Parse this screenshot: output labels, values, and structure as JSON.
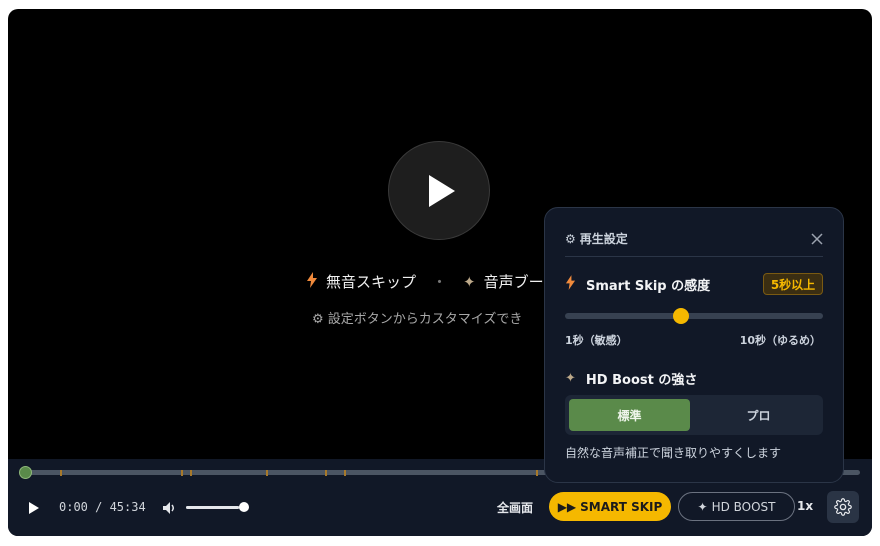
{
  "overlay": {
    "feature_skip": "無音スキップ",
    "separator": "・",
    "feature_boost": "音声ブー",
    "hint": "設定ボタンからカスタマイズでき"
  },
  "controls": {
    "time": "0:00 / 45:34",
    "volume_level": 0.92,
    "progress": 0.0,
    "fullscreen_label": "全画面",
    "smart_skip_label": "SMART SKIP",
    "hd_boost_label": "HD BOOST",
    "speed_label": "1x"
  },
  "panel": {
    "title": "再生設定",
    "smart_skip": {
      "title": "Smart Skip の感度",
      "badge": "5秒以上",
      "min_label": "1秒（敏感）",
      "max_label": "10秒（ゆるめ）",
      "level": 0.45
    },
    "hd_boost": {
      "title": "HD Boost の強さ",
      "options": [
        "標準",
        "プロ"
      ],
      "selected": "標準",
      "description": "自然な音声補正で聞き取りやすくします"
    }
  },
  "colors": {
    "accent_yellow": "#f5b800",
    "accent_green": "#5a8a4a",
    "bolt_orange": "#f08a3c",
    "panel_bg": "#111827"
  },
  "icons": {
    "play": "play-icon",
    "volume": "volume-icon",
    "settings": "gear-icon",
    "close": "close-icon",
    "bolt": "bolt-icon",
    "sparkle": "sparkle-icon"
  }
}
